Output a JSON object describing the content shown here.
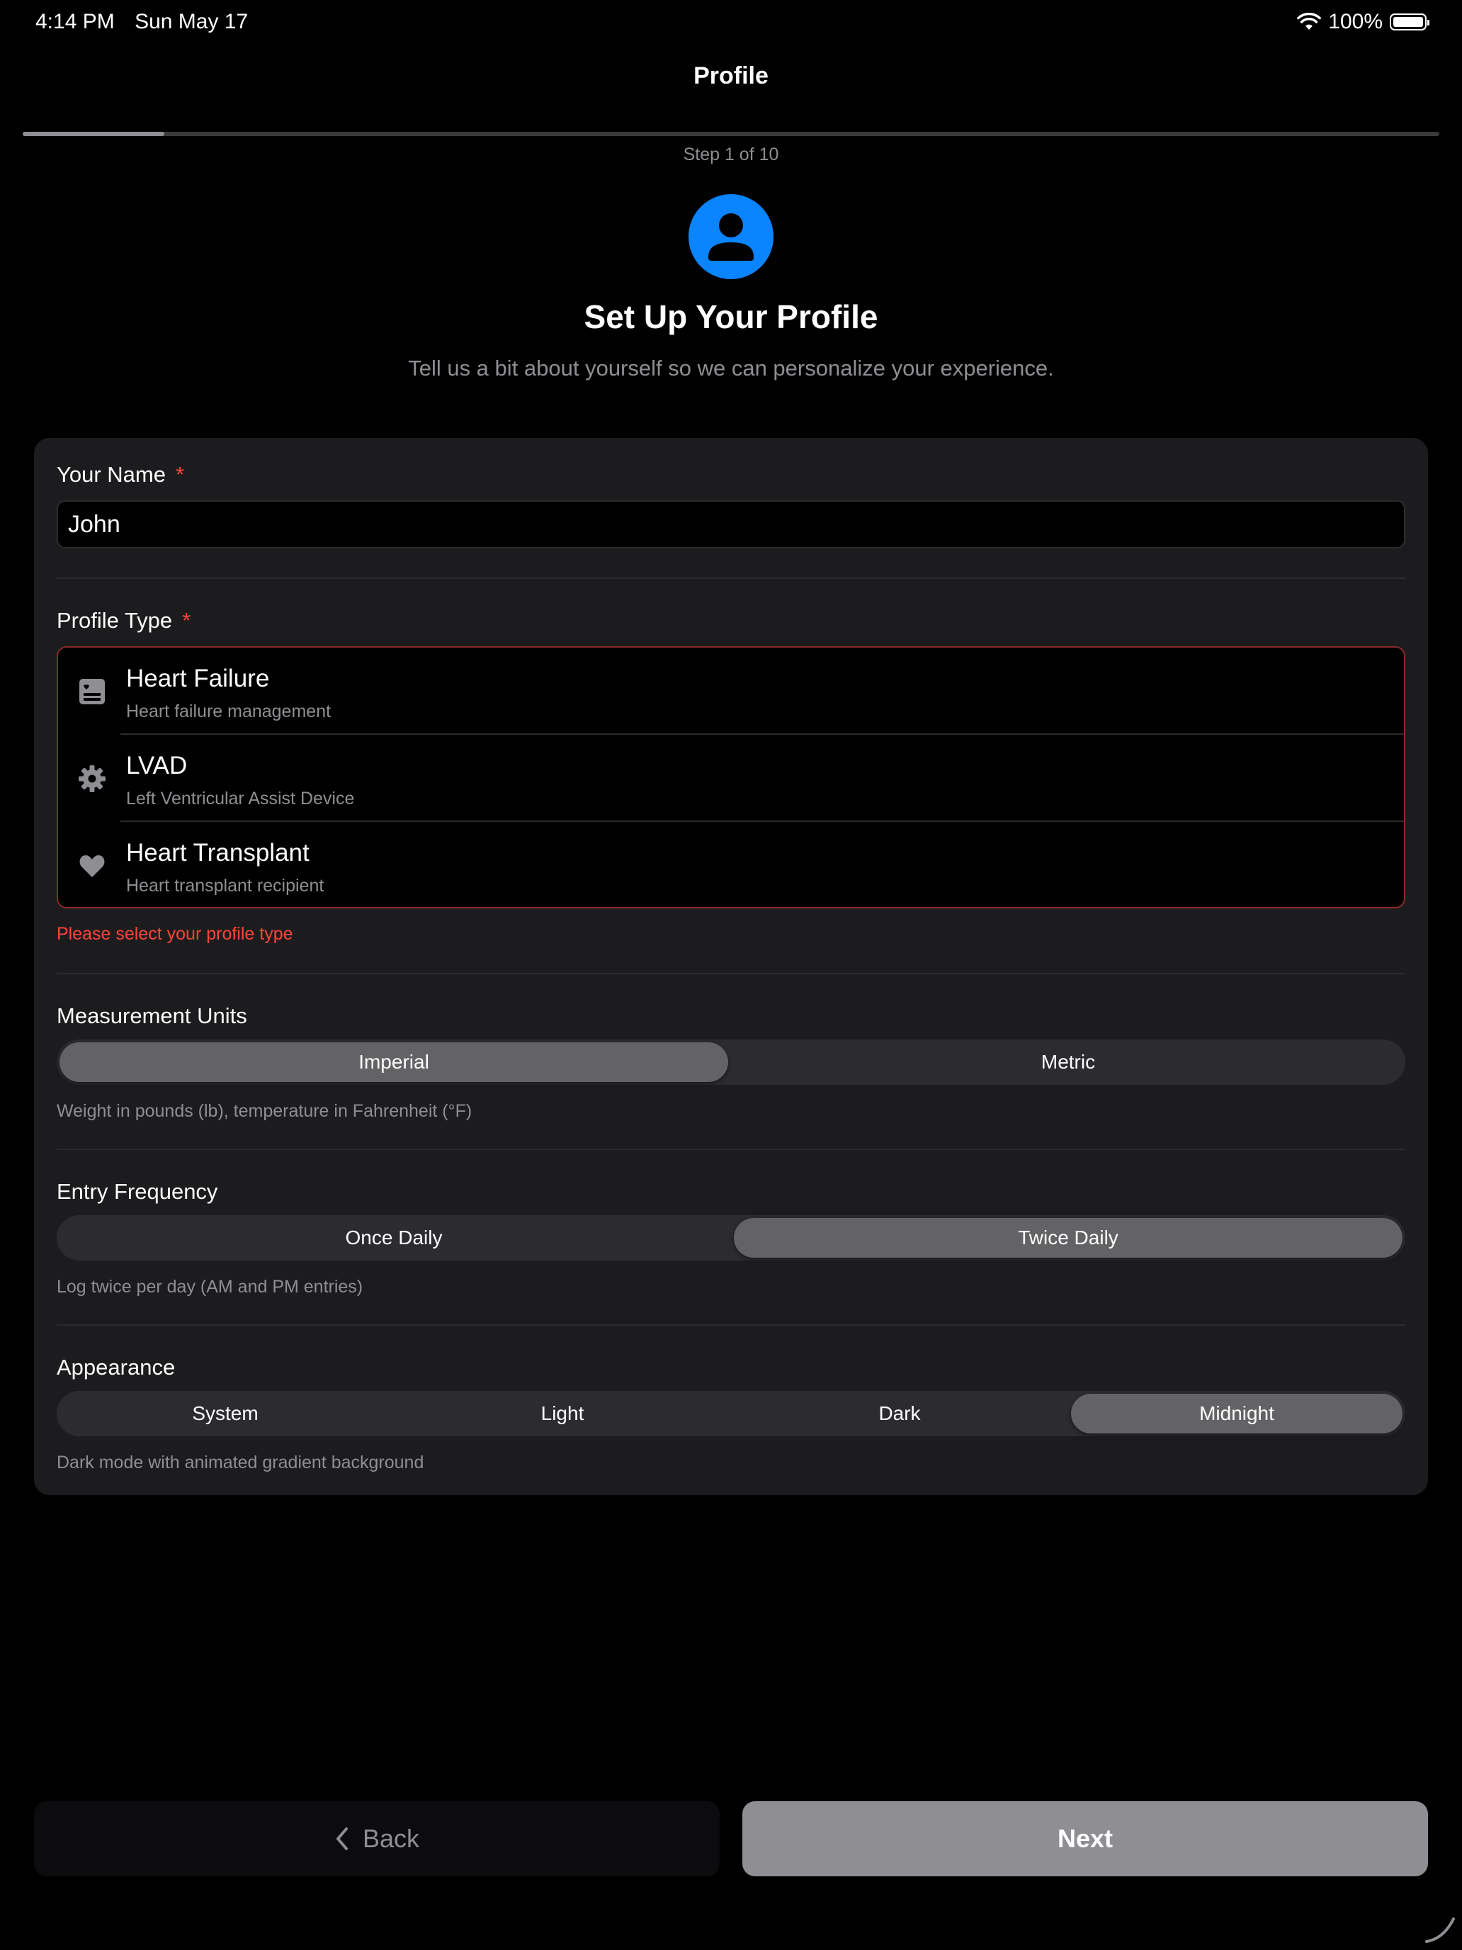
{
  "status_bar": {
    "time": "4:14 PM",
    "date": "Sun May 17",
    "battery": "100%"
  },
  "nav": {
    "title": "Profile"
  },
  "progress": {
    "step_text": "Step 1 of 10",
    "fraction": 0.1
  },
  "header": {
    "icon": "person-icon",
    "title": "Set Up Your Profile",
    "subtitle": "Tell us a bit about yourself so we can personalize your experience."
  },
  "form": {
    "name": {
      "label": "Your Name",
      "required_mark": "*",
      "value": "John"
    },
    "profile_type": {
      "label": "Profile Type",
      "required_mark": "*",
      "options": [
        {
          "title": "Heart Failure",
          "description": "Heart failure management",
          "icon": "medical-card-icon"
        },
        {
          "title": "LVAD",
          "description": "Left Ventricular Assist Device",
          "icon": "gear-icon"
        },
        {
          "title": "Heart Transplant",
          "description": "Heart transplant recipient",
          "icon": "heart-icon"
        }
      ],
      "error": "Please select your profile type"
    },
    "units": {
      "label": "Measurement Units",
      "options": [
        "Imperial",
        "Metric"
      ],
      "selected": "Imperial",
      "hint": "Weight in pounds (lb), temperature in Fahrenheit (°F)"
    },
    "frequency": {
      "label": "Entry Frequency",
      "options": [
        "Once Daily",
        "Twice Daily"
      ],
      "selected": "Twice Daily",
      "hint": "Log twice per day (AM and PM entries)"
    },
    "appearance": {
      "label": "Appearance",
      "options": [
        "System",
        "Light",
        "Dark",
        "Midnight"
      ],
      "selected": "Midnight",
      "hint": "Dark mode with animated gradient background"
    }
  },
  "footer": {
    "back_label": "Back",
    "next_label": "Next"
  },
  "colors": {
    "accent": "#0a84ff",
    "error": "#ff453a",
    "card": "#1c1c1e"
  }
}
